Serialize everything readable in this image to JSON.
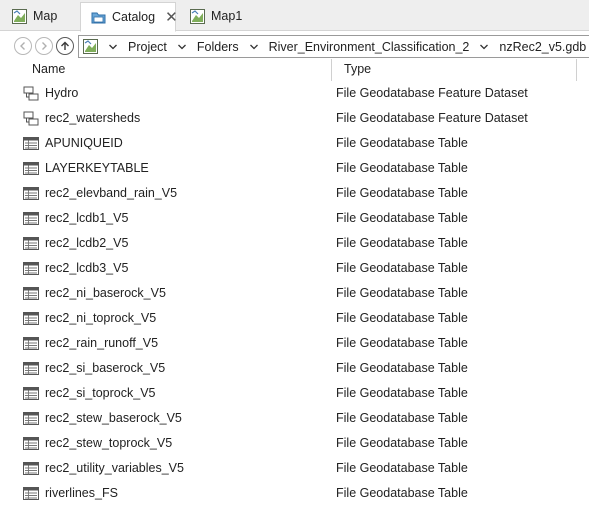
{
  "tabs": [
    {
      "label": "Map",
      "icon": "map-icon",
      "active": false
    },
    {
      "label": "Catalog",
      "icon": "catalog-folder-icon",
      "active": true
    },
    {
      "label": "Map1",
      "icon": "map-icon",
      "active": false
    }
  ],
  "breadcrumb": [
    "Project",
    "Folders",
    "River_Environment_Classification_2",
    "nzRec2_v5.gdb"
  ],
  "columns": {
    "name": "Name",
    "type": "Type"
  },
  "items": [
    {
      "name": "Hydro",
      "type": "File Geodatabase Feature Dataset",
      "icon": "feature-dataset-icon"
    },
    {
      "name": "rec2_watersheds",
      "type": "File Geodatabase Feature Dataset",
      "icon": "feature-dataset-icon"
    },
    {
      "name": "APUNIQUEID",
      "type": "File Geodatabase Table",
      "icon": "table-icon"
    },
    {
      "name": "LAYERKEYTABLE",
      "type": "File Geodatabase Table",
      "icon": "table-icon"
    },
    {
      "name": "rec2_elevband_rain_V5",
      "type": "File Geodatabase Table",
      "icon": "table-icon"
    },
    {
      "name": "rec2_lcdb1_V5",
      "type": "File Geodatabase Table",
      "icon": "table-icon"
    },
    {
      "name": "rec2_lcdb2_V5",
      "type": "File Geodatabase Table",
      "icon": "table-icon"
    },
    {
      "name": "rec2_lcdb3_V5",
      "type": "File Geodatabase Table",
      "icon": "table-icon"
    },
    {
      "name": "rec2_ni_baserock_V5",
      "type": "File Geodatabase Table",
      "icon": "table-icon"
    },
    {
      "name": "rec2_ni_toprock_V5",
      "type": "File Geodatabase Table",
      "icon": "table-icon"
    },
    {
      "name": "rec2_rain_runoff_V5",
      "type": "File Geodatabase Table",
      "icon": "table-icon"
    },
    {
      "name": "rec2_si_baserock_V5",
      "type": "File Geodatabase Table",
      "icon": "table-icon"
    },
    {
      "name": "rec2_si_toprock_V5",
      "type": "File Geodatabase Table",
      "icon": "table-icon"
    },
    {
      "name": "rec2_stew_baserock_V5",
      "type": "File Geodatabase Table",
      "icon": "table-icon"
    },
    {
      "name": "rec2_stew_toprock_V5",
      "type": "File Geodatabase Table",
      "icon": "table-icon"
    },
    {
      "name": "rec2_utility_variables_V5",
      "type": "File Geodatabase Table",
      "icon": "table-icon"
    },
    {
      "name": "riverlines_FS",
      "type": "File Geodatabase Table",
      "icon": "table-icon"
    }
  ]
}
